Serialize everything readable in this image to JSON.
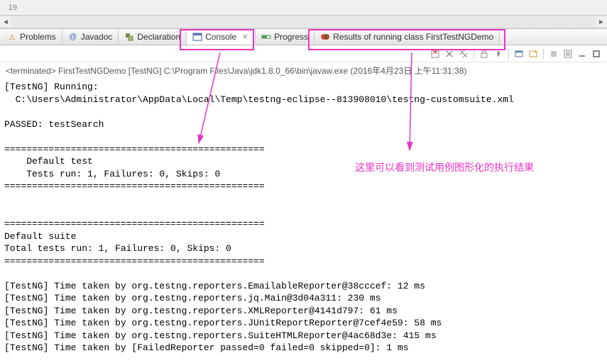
{
  "editor": {
    "line_number": "19"
  },
  "tabs": {
    "problems": "Problems",
    "javadoc": "Javadoc",
    "declaration": "Declaration",
    "console": "Console",
    "progress": "Progress",
    "results": "Results of running class FirstTestNGDemo"
  },
  "status": {
    "terminated": "<terminated> FirstTestNGDemo [TestNG] C:\\Program Files\\Java\\jdk1.8.0_66\\bin\\javaw.exe (2016年4月23日 上午11:31:38)"
  },
  "console": {
    "output": "[TestNG] Running:\n  C:\\Users\\Administrator\\AppData\\Local\\Temp\\testng-eclipse--813908010\\testng-customsuite.xml\n\nPASSED: testSearch\n\n===============================================\n    Default test\n    Tests run: 1, Failures: 0, Skips: 0\n===============================================\n\n\n===============================================\nDefault suite\nTotal tests run: 1, Failures: 0, Skips: 0\n===============================================\n\n[TestNG] Time taken by org.testng.reporters.EmailableReporter@38cccef: 12 ms\n[TestNG] Time taken by org.testng.reporters.jq.Main@3d04a311: 230 ms\n[TestNG] Time taken by org.testng.reporters.XMLReporter@4141d797: 61 ms\n[TestNG] Time taken by org.testng.reporters.JUnitReportReporter@7cef4e59: 58 ms\n[TestNG] Time taken by org.testng.reporters.SuiteHTMLReporter@4ac68d3e: 415 ms\n[TestNG] Time taken by [FailedReporter passed=0 failed=0 skipped=0]: 1 ms"
  },
  "annotation": {
    "text": "这里可以看到测试用例图形化的执行结果"
  },
  "toolbar": {
    "buttons": [
      "clear-console",
      "show-console",
      "pin",
      "display-options",
      "terminate",
      "remove-launch",
      "remove-all",
      "scroll-lock",
      "show-stdout",
      "show-stderr",
      "min-max"
    ]
  }
}
